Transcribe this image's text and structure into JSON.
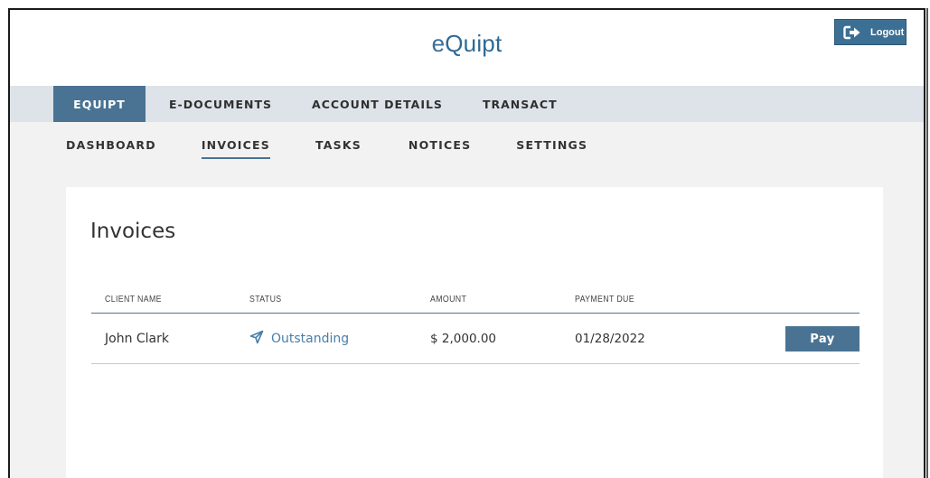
{
  "header": {
    "brand_e": "e",
    "brand_rest": "Quipt",
    "logout_label": "Logout",
    "logout_icon": "logout-icon"
  },
  "topnav": {
    "items": [
      {
        "label": "EQUIPT",
        "active": true
      },
      {
        "label": "E-DOCUMENTS",
        "active": false
      },
      {
        "label": "ACCOUNT DETAILS",
        "active": false
      },
      {
        "label": "TRANSACT",
        "active": false
      }
    ]
  },
  "subnav": {
    "items": [
      {
        "label": "DASHBOARD",
        "active": false
      },
      {
        "label": "INVOICES",
        "active": true
      },
      {
        "label": "TASKS",
        "active": false
      },
      {
        "label": "NOTICES",
        "active": false
      },
      {
        "label": "SETTINGS",
        "active": false
      }
    ]
  },
  "main": {
    "title": "Invoices",
    "table": {
      "columns": [
        "CLIENT NAME",
        "STATUS",
        "AMOUNT",
        "PAYMENT DUE"
      ],
      "rows": [
        {
          "client_name": "John Clark",
          "status": "Outstanding",
          "status_icon": "send-icon",
          "amount": "$ 2,000.00",
          "payment_due": "01/28/2022",
          "action_label": "Pay"
        }
      ]
    }
  },
  "colors": {
    "accent": "#4a7393",
    "brand": "#3b6f97",
    "status_link": "#4a7ea8",
    "nav_bg": "#dde3e8",
    "page_bg": "#f2f2f2"
  }
}
